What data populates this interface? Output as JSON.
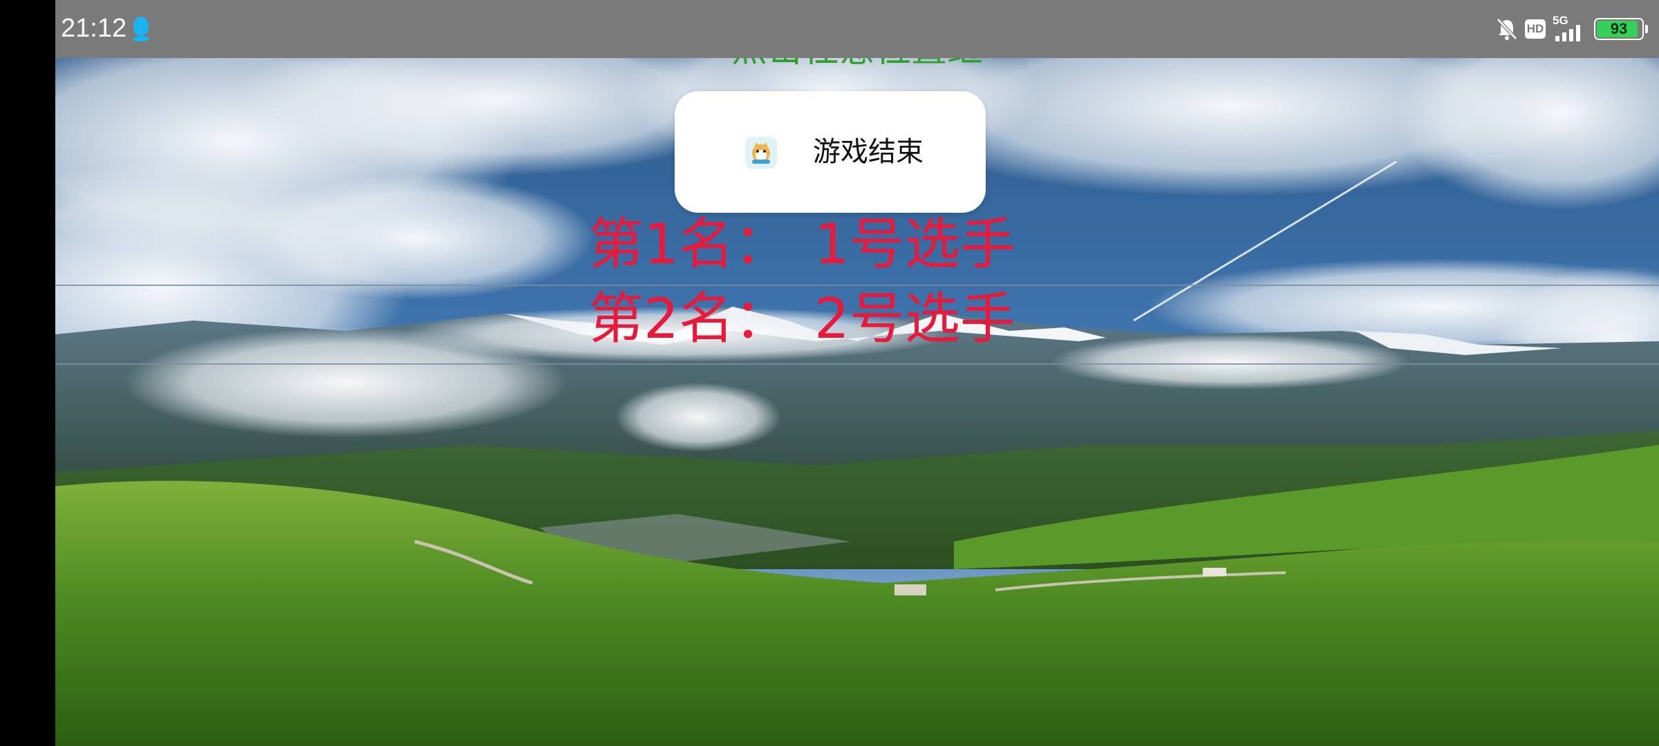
{
  "status_bar": {
    "time": "21:12",
    "network": "5G",
    "hd_label": "HD",
    "battery_percent": "93",
    "battery_level": 0.93
  },
  "game": {
    "top_hint": "点击任意位置继",
    "rankings": [
      {
        "label": "第1名：",
        "name": "1号选手"
      },
      {
        "label": "第2名：",
        "name": "2号选手"
      }
    ]
  },
  "toast": {
    "text": "游戏结束",
    "icon": "app-icon"
  },
  "colors": {
    "ranking_text": "#e8193a",
    "hint_text": "#2da02a",
    "status_bar_bg": "#7a7a7a",
    "battery_fill": "#33d15a"
  }
}
